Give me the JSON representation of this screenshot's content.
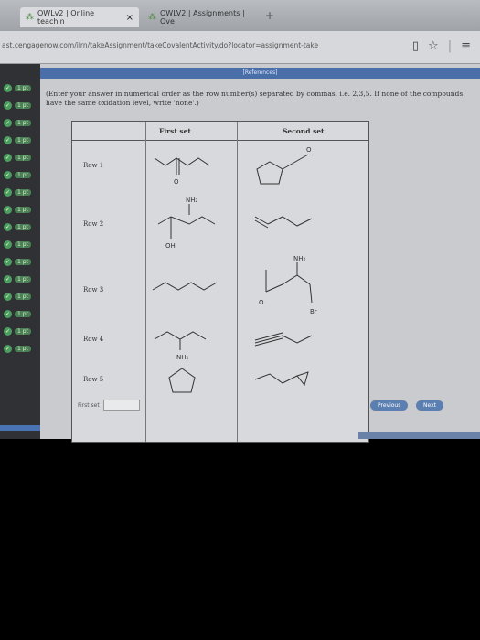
{
  "browser": {
    "tabs": [
      {
        "label": "OWLv2 | Online teachin"
      },
      {
        "label": "OWLV2 | Assignments | Ove"
      }
    ],
    "new_tab": "+",
    "url": "ast.cengagenow.com/ilrn/takeAssignment/takeCovalentActivity.do?locator=assignment-take",
    "close": "×"
  },
  "sidebar": {
    "items": [
      {
        "label": "1 pt"
      },
      {
        "label": "1 pt"
      },
      {
        "label": "1 pt"
      },
      {
        "label": "1 pt"
      },
      {
        "label": "1 pt"
      },
      {
        "label": "1 pt"
      },
      {
        "label": "1 pt"
      },
      {
        "label": "1 pt"
      },
      {
        "label": "1 pt"
      },
      {
        "label": "1 pt"
      },
      {
        "label": "1 pt"
      },
      {
        "label": "1 pt"
      },
      {
        "label": "1 pt"
      },
      {
        "label": "1 pt"
      },
      {
        "label": "1 pt"
      },
      {
        "label": "1 pt"
      }
    ]
  },
  "question": {
    "references": "[References]",
    "instructions": "(Enter your answer in numerical order as the row number(s) separated by commas, i.e. 2,3,5. If none of the compounds have the same oxidation level, write 'none'.)",
    "col_first": "First set",
    "col_second": "Second set",
    "rows": [
      {
        "label": "Row 1"
      },
      {
        "label": "Row 2"
      },
      {
        "label": "Row 3"
      },
      {
        "label": "Row 4"
      },
      {
        "label": "Row 5"
      }
    ],
    "atoms": {
      "o": "O",
      "nh2": "NH₂",
      "oh": "OH",
      "br": "Br"
    }
  },
  "answer": {
    "first_set_label": "First set"
  },
  "nav": {
    "previous": "Previous",
    "next": "Next"
  }
}
